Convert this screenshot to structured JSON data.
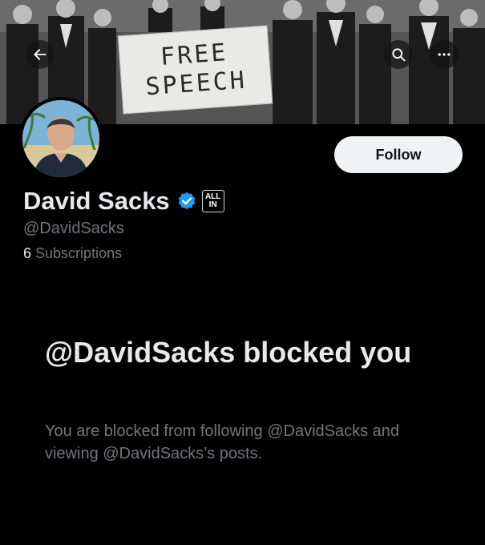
{
  "header": {
    "banner_sign_line1": "FREE",
    "banner_sign_line2": "SPEECH",
    "back_icon": "arrow-left-icon",
    "search_icon": "search-icon",
    "more_icon": "more-horizontal-icon"
  },
  "profile": {
    "follow_label": "Follow",
    "name": "David Sacks",
    "verified_icon": "verified-badge-icon",
    "affiliation_line1": "ALL",
    "affiliation_line2": "IN",
    "handle": "@DavidSacks",
    "subscriptions_count": "6",
    "subscriptions_label": "Subscriptions"
  },
  "blocked": {
    "title": "@DavidSacks blocked you",
    "description": "You are blocked from following @DavidSacks and viewing @DavidSacks’s posts."
  },
  "colors": {
    "background": "#000000",
    "primary_text": "#e7e9ea",
    "secondary_text": "#71767b",
    "verified_blue": "#1d9bf0",
    "follow_button_bg": "#eff3f4"
  }
}
